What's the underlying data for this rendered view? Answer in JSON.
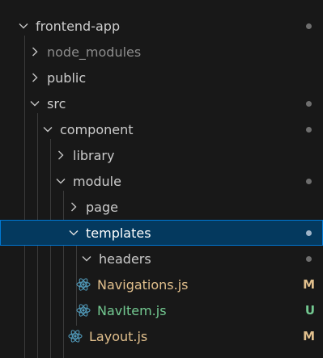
{
  "tree": {
    "items": [
      {
        "label": "frontend-app",
        "kind": "folder",
        "expanded": true,
        "status": "dot"
      },
      {
        "label": "node_modules",
        "kind": "folder",
        "expanded": false,
        "status": "none"
      },
      {
        "label": "public",
        "kind": "folder",
        "expanded": false,
        "status": "none"
      },
      {
        "label": "src",
        "kind": "folder",
        "expanded": true,
        "status": "dot"
      },
      {
        "label": "component",
        "kind": "folder",
        "expanded": true,
        "status": "dot"
      },
      {
        "label": "library",
        "kind": "folder",
        "expanded": false,
        "status": "none"
      },
      {
        "label": "module",
        "kind": "folder",
        "expanded": true,
        "status": "dot"
      },
      {
        "label": "page",
        "kind": "folder",
        "expanded": false,
        "status": "none"
      },
      {
        "label": "templates",
        "kind": "folder",
        "expanded": true,
        "status": "dot",
        "selected": true
      },
      {
        "label": "headers",
        "kind": "folder",
        "expanded": true,
        "status": "dot"
      },
      {
        "label": "Navigations.js",
        "kind": "file",
        "icon": "react-icon",
        "status": "M"
      },
      {
        "label": "NavItem.js",
        "kind": "file",
        "icon": "react-icon",
        "status": "U"
      },
      {
        "label": "Layout.js",
        "kind": "file",
        "icon": "react-icon",
        "status": "M"
      }
    ]
  },
  "colors": {
    "background": "#181818",
    "selection": "#04395e",
    "selection_border": "#0078d4",
    "modified": "#e2c08d",
    "untracked": "#73c991",
    "ignored": "#8c8c8c",
    "react": "#519aba"
  }
}
